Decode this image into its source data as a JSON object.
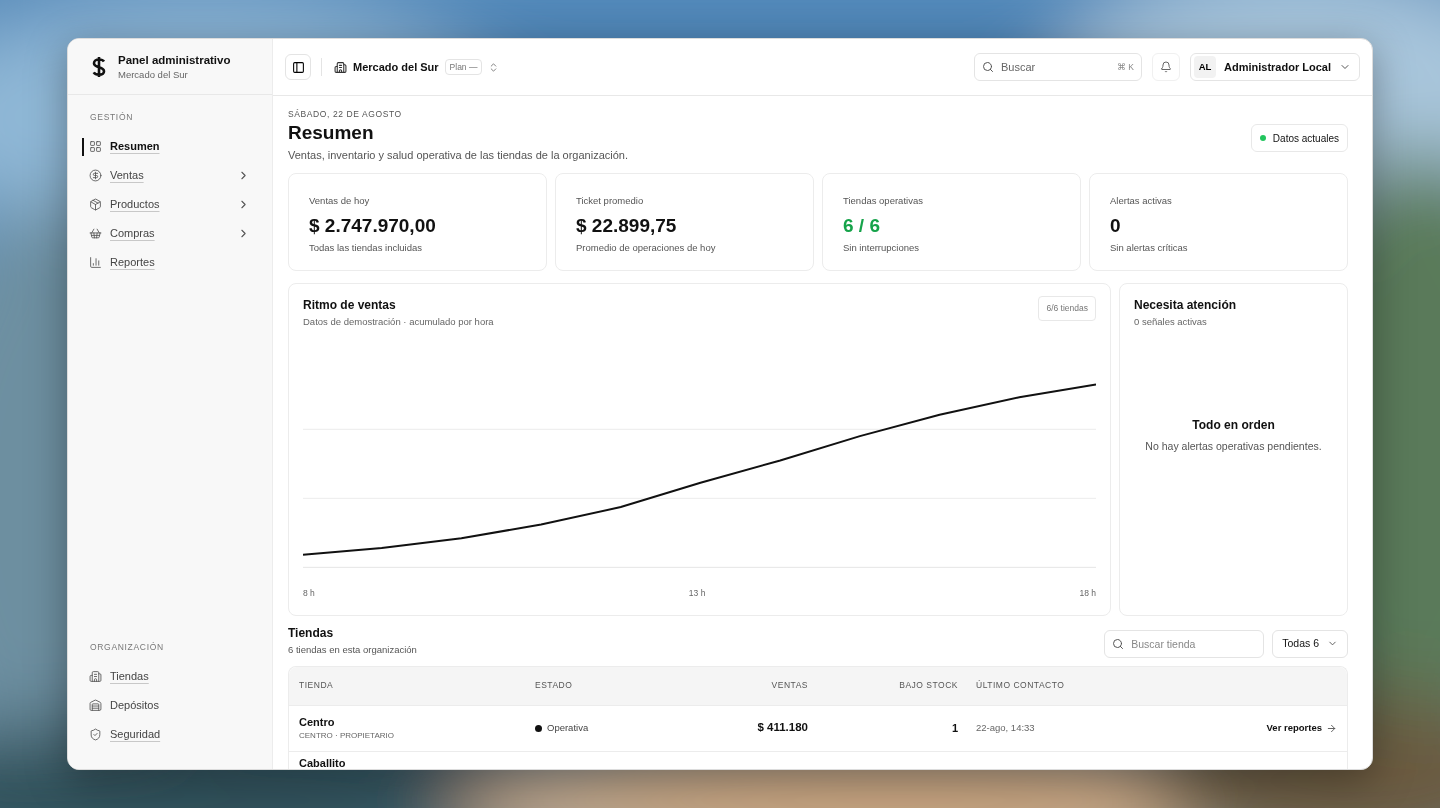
{
  "sidebar": {
    "brand": {
      "title": "Panel administrativo",
      "subtitle": "Mercado del Sur"
    },
    "sections": [
      {
        "heading": "GESTIÓN",
        "items": [
          {
            "label": "Resumen",
            "selected": true,
            "underlined": true,
            "expandable": false
          },
          {
            "label": "Ventas",
            "selected": false,
            "underlined": true,
            "expandable": true
          },
          {
            "label": "Productos",
            "selected": false,
            "underlined": true,
            "expandable": true
          },
          {
            "label": "Compras",
            "selected": false,
            "underlined": true,
            "expandable": true
          },
          {
            "label": "Reportes",
            "selected": false,
            "underlined": true,
            "expandable": false
          }
        ]
      },
      {
        "heading": "ORGANIZACIÓN",
        "items": [
          {
            "label": "Tiendas",
            "selected": false,
            "underlined": true,
            "expandable": false
          },
          {
            "label": "Depósitos",
            "selected": false,
            "underlined": false,
            "expandable": false
          },
          {
            "label": "Seguridad",
            "selected": false,
            "underlined": true,
            "expandable": false
          }
        ]
      }
    ]
  },
  "topbar": {
    "organization": "Mercado del Sur",
    "plan": "Plan —",
    "search": {
      "placeholder": "Buscar",
      "shortcut": "⌘ K"
    },
    "user": {
      "initials": "AL",
      "name": "Administrador Local"
    }
  },
  "header": {
    "date": "SÁBADO, 22 DE AGOSTO",
    "title": "Resumen",
    "description": "Ventas, inventario y salud operativa de las tiendas de la organización.",
    "status": {
      "label": "Datos actuales",
      "color": "#22c55e"
    }
  },
  "kpis": [
    {
      "label": "Ventas de hoy",
      "value": "$ 2.747.970,00",
      "note": "Todas las tiendas incluidas",
      "positive": false
    },
    {
      "label": "Ticket promedio",
      "value": "$ 22.899,75",
      "note": "Promedio de operaciones de hoy",
      "positive": false
    },
    {
      "label": "Tiendas operativas",
      "value": "6 / 6",
      "note": "Sin interrupciones",
      "positive": true
    },
    {
      "label": "Alertas activas",
      "value": "0",
      "note": "Sin alertas críticas",
      "positive": false
    }
  ],
  "sales_chart": {
    "title": "Ritmo de ventas",
    "subtitle": "Datos de demostración · acumulado por hora",
    "badge": "6/6 tiendas",
    "x_labels": [
      "8 h",
      "13 h",
      "18 h"
    ]
  },
  "attention": {
    "title": "Necesita atención",
    "subtitle": "0 señales activas",
    "empty_title": "Todo en orden",
    "empty_text": "No hay alertas operativas pendientes."
  },
  "stores": {
    "title": "Tiendas",
    "subtitle": "6 tiendas en esta organización",
    "search": {
      "placeholder": "Buscar tienda"
    },
    "filter": "Todas 6",
    "table": {
      "columns": [
        "TIENDA",
        "ESTADO",
        "VENTAS",
        "BAJO STOCK",
        "ÚLTIMO CONTACTO"
      ],
      "rows": [
        {
          "name": "Centro",
          "detail": "CENTRO · PROPIETARIO",
          "status": {
            "label": "Operativa",
            "color": "#111111"
          },
          "sales": "$ 411.180",
          "low_stock": "1",
          "last_contact": "22-ago, 14:33",
          "action": "Ver reportes"
        },
        {
          "name": "Caballito"
        }
      ]
    }
  }
}
